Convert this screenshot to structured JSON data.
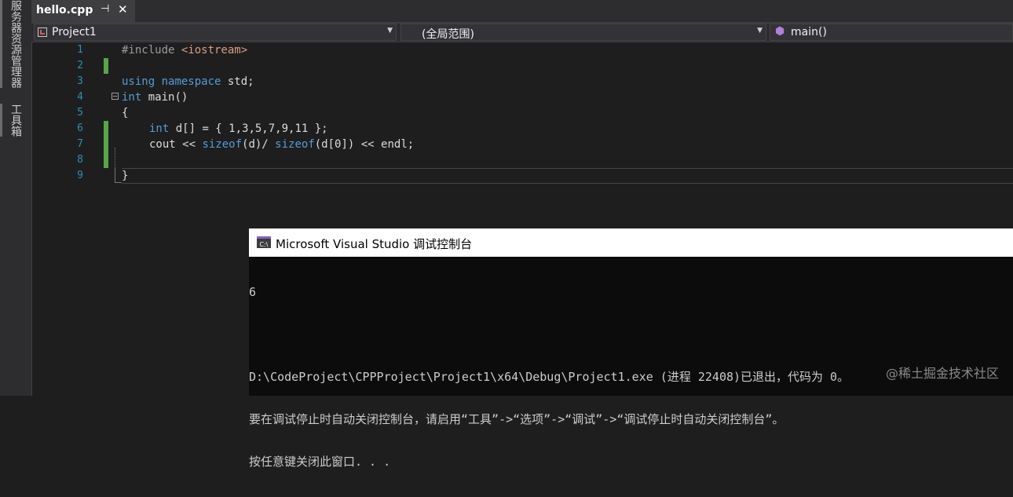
{
  "sidebar": {
    "tabs": [
      {
        "label": "服务器资源管理器"
      },
      {
        "label": "工具箱"
      }
    ]
  },
  "tabbar": {
    "active_tab": "hello.cpp",
    "pin_glyph": "⊣",
    "close_glyph": "✕"
  },
  "navbar": {
    "project": "Project1",
    "scope": "(全局范围)",
    "member": "main()"
  },
  "editor": {
    "line_numbers": [
      "1",
      "2",
      "3",
      "4",
      "5",
      "6",
      "7",
      "8",
      "9"
    ],
    "lines": {
      "l1_pp": "#include ",
      "l1_inc": "<iostream>",
      "l3_kw1": "using",
      "l3_kw2": "namespace",
      "l3_rest": " std;",
      "l4_kw": "int",
      "l4_rest": " main()",
      "l5": "{",
      "l6_kw": "int",
      "l6_rest": " d[] = { 1,3,5,7,9,11 };",
      "l7_a": "cout << ",
      "l7_kw1": "sizeof",
      "l7_b": "(d)/ ",
      "l7_kw2": "sizeof",
      "l7_c": "(d[0]) << endl;",
      "l9": "}"
    }
  },
  "console": {
    "title": "Microsoft Visual Studio 调试控制台",
    "icon_text": "C:\\",
    "lines": [
      "6",
      "",
      "D:\\CodeProject\\CPPProject\\Project1\\x64\\Debug\\Project1.exe (进程 22408)已退出，代码为 0。",
      "要在调试停止时自动关闭控制台，请启用“工具”->“选项”->“调试”->“调试停止时自动关闭控制台”。",
      "按任意键关闭此窗口. . ."
    ]
  },
  "watermark": "@稀土掘金技术社区",
  "colors": {
    "background": "#1e1e1e",
    "keyword": "#569cd6",
    "preprocessor": "#9b9b9b",
    "include_string": "#d69d85",
    "line_number": "#2b91af",
    "change_bar": "#57a64a"
  }
}
